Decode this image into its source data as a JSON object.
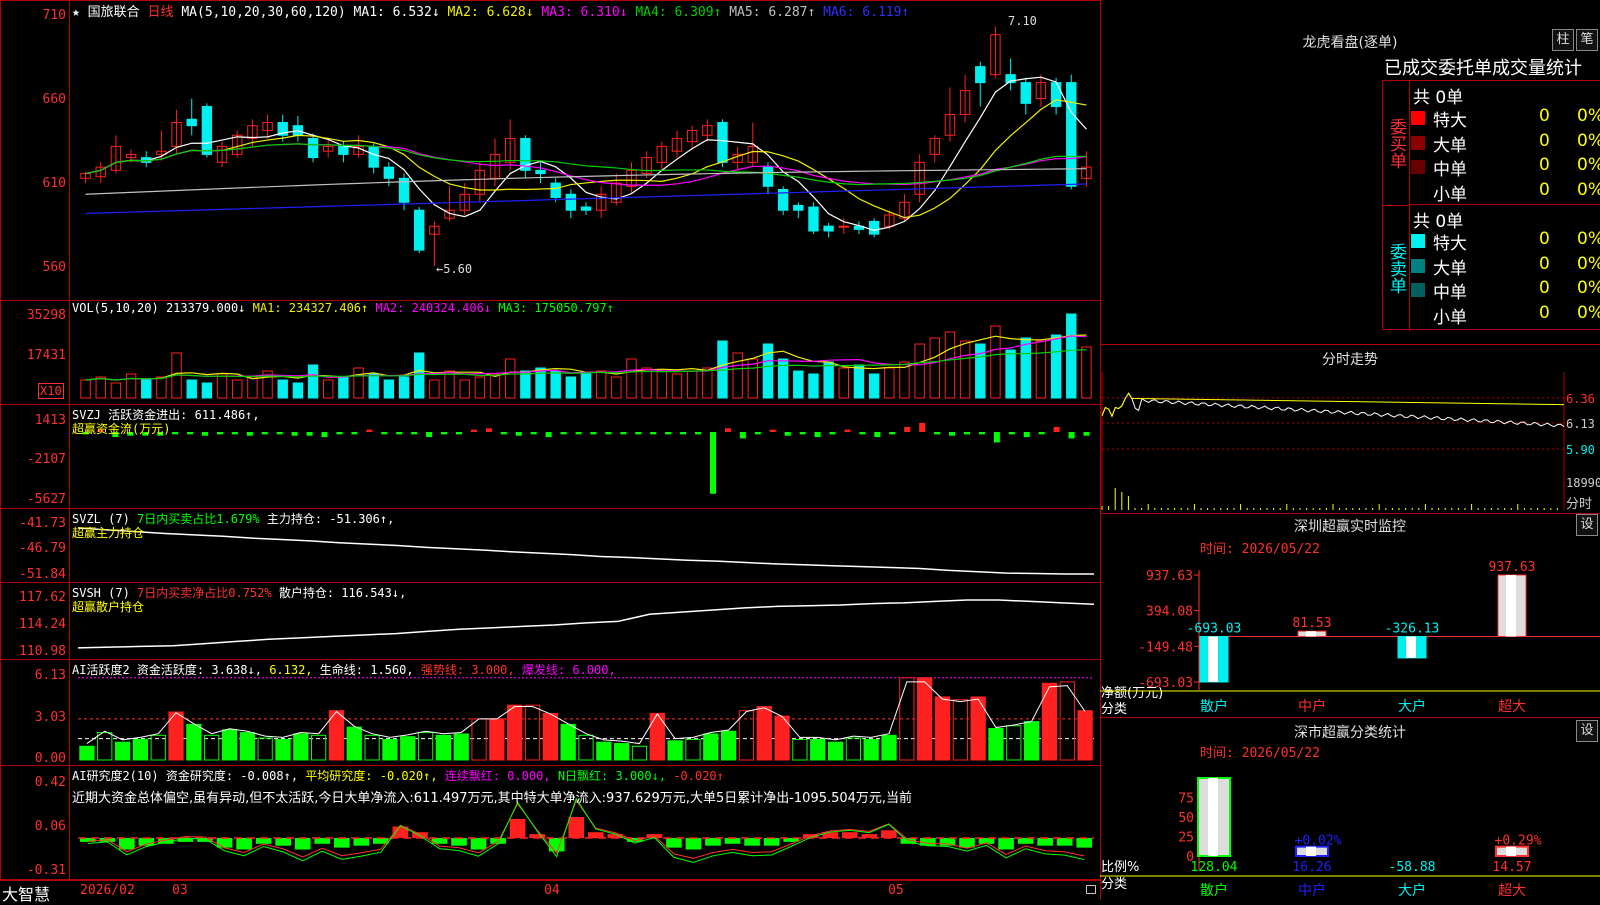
{
  "colors": {
    "up": "#ff2020",
    "down": "#00f0f0",
    "grid": "#b00000",
    "ma1": "#ffffff",
    "ma2": "#f0f000",
    "ma3": "#ff00ff",
    "ma4": "#00d000",
    "ma5": "#c0c0c0",
    "ma6": "#2020ff",
    "green": "#00ff00",
    "yellow": "#ffff00"
  },
  "main": {
    "star": "★",
    "name": "国旅联合",
    "period": "日线",
    "ma_params": "MA(5,10,20,30,60,120)",
    "ma1": "MA1: 6.532↓",
    "ma2": "MA2: 6.628↓",
    "ma3": "MA3: 6.310↓",
    "ma4": "MA4: 6.309↑",
    "ma5": "MA5: 6.287↑",
    "ma6": "MA6: 6.119↑",
    "axis": [
      "710",
      "660",
      "610",
      "560"
    ],
    "hi_label": "7.10",
    "lo_label": "←5.60"
  },
  "vol": {
    "title": "VOL(5,10,20)",
    "value": "213379.000↓",
    "ma1": "MA1: 234327.406↑",
    "ma2": "MA2: 240324.406↓",
    "ma3": "MA3: 175050.797↑",
    "axis": [
      "35298",
      "17431"
    ],
    "unit": "X10"
  },
  "svzj": {
    "title": "SVZJ",
    "name": "活跃资金进出:",
    "value": "611.486↑,",
    "sub": "超赢资金流(万元)",
    "axis": [
      "1413",
      "-2107",
      "-5627"
    ]
  },
  "svzl": {
    "title": "SVZL (7)",
    "ratio": "7日内买卖占比1.679%",
    "holding": "主力持仓: -51.306↑,",
    "sub": "超赢主力持仓",
    "axis": [
      "-41.73",
      "-46.79",
      "-51.84"
    ]
  },
  "svsh": {
    "title": "SVSH (7)",
    "ratio": "7日内买卖净占比0.752%",
    "holding": "散户持仓: 116.543↓,",
    "sub": "超赢散户持仓",
    "axis": [
      "117.62",
      "114.24",
      "110.98"
    ]
  },
  "ai1": {
    "title": "AI活跃度2",
    "v1": "资金活跃度: 3.638↓,",
    "v2": "6.132,",
    "v3": "生命线: 1.560,",
    "v4": "强势线: 3.000,",
    "v5": "爆发线: 6.000,",
    "axis": [
      "6.13",
      "3.03",
      "0.00"
    ]
  },
  "ai2": {
    "title": "AI研究度2(10)",
    "v1": "资金研究度: -0.008↑,",
    "v2": "平均研究度: -0.020↑,",
    "v3": "连续飘红: 0.000,",
    "v4": "N日飘红: 3.000↓,",
    "v5": "-0.020↑",
    "comment": "近期大资金总体偏空,虽有异动,但不太活跃,今日大单净流入:611.497万元,其中特大单净流入:937.629万元,大单5日累计净出-1095.504万元,当前",
    "axis": [
      "0.42",
      "0.06",
      "-0.31"
    ]
  },
  "dates": {
    "brand": "大智慧",
    "d1": "2026/02",
    "d2": "03",
    "d3": "04",
    "d4": "05"
  },
  "right": {
    "title": "龙虎看盘(逐单)",
    "btn1": "柱",
    "btn2": "笔",
    "table_title": "已成交委托单成交量统计",
    "buy_label": "委买单",
    "sell_label": "委卖单",
    "buy_total": "共 0单",
    "sell_total": "共 0单",
    "rows": [
      {
        "name": "特大",
        "count": "0",
        "pct": "0%"
      },
      {
        "name": "大单",
        "count": "0",
        "pct": "0%"
      },
      {
        "name": "中单",
        "count": "0",
        "pct": "0%"
      },
      {
        "name": "小单",
        "count": "0",
        "pct": "0%"
      }
    ],
    "fenshi_title": "分时走势",
    "fenshi_axis": [
      "6.36",
      "6.13",
      "5.90"
    ],
    "fenshi_vol": "18990",
    "fenshi_unit": "分时",
    "sz_title": "深圳超赢实时监控",
    "sz_btn": "设",
    "sz_time": "时间: 2026/05/22",
    "sz_axis": [
      "937.63",
      "394.08",
      "-149.48",
      "-693.03"
    ],
    "sz_bars": [
      {
        "cat": "散户",
        "value": -693.03,
        "label": "-693.03"
      },
      {
        "cat": "中户",
        "value": 81.53,
        "label": "81.53"
      },
      {
        "cat": "大户",
        "value": -326.13,
        "label": "-326.13"
      },
      {
        "cat": "超大",
        "value": 937.63,
        "label": "937.63"
      }
    ],
    "sz_ylabel": "净额(万元)",
    "sz_xlabel": "分类",
    "sc_title": "深市超赢分类统计",
    "sc_btn": "设",
    "sc_time": "时间: 2026/05/22",
    "sc_axis": [
      "75",
      "50",
      "25",
      "0"
    ],
    "sc_bars": [
      {
        "cat": "散户",
        "value": 128.04,
        "label": "128.04",
        "pct": ""
      },
      {
        "cat": "中户",
        "value": 16.26,
        "label": "16.26",
        "pct": "+0.02%"
      },
      {
        "cat": "大户",
        "value": -58.88,
        "label": "-58.88",
        "pct": ""
      },
      {
        "cat": "超大",
        "value": 14.57,
        "label": "14.57",
        "pct": "+0.29%"
      }
    ],
    "sc_ylabel": "比例%",
    "sc_xlabel": "分类"
  },
  "chart_data": {
    "type": "candlestick",
    "title": "国旅联合 日线",
    "y_range": [
      5.45,
      7.18
    ],
    "candles": [
      [
        6.15,
        6.18,
        6.12,
        6.19
      ],
      [
        6.16,
        6.22,
        6.12,
        6.25
      ],
      [
        6.2,
        6.35,
        6.18,
        6.42
      ],
      [
        6.28,
        6.3,
        6.25,
        6.33
      ],
      [
        6.28,
        6.25,
        6.22,
        6.32
      ],
      [
        6.3,
        6.32,
        6.26,
        6.45
      ],
      [
        6.35,
        6.5,
        6.3,
        6.58
      ],
      [
        6.52,
        6.48,
        6.42,
        6.65
      ],
      [
        6.6,
        6.3,
        6.28,
        6.62
      ],
      [
        6.25,
        6.35,
        6.22,
        6.38
      ],
      [
        6.3,
        6.42,
        6.28,
        6.45
      ],
      [
        6.4,
        6.48,
        6.35,
        6.52
      ],
      [
        6.45,
        6.5,
        6.4,
        6.55
      ],
      [
        6.5,
        6.42,
        6.38,
        6.55
      ],
      [
        6.48,
        6.42,
        6.38,
        6.54
      ],
      [
        6.4,
        6.28,
        6.25,
        6.43
      ],
      [
        6.32,
        6.35,
        6.28,
        6.4
      ],
      [
        6.35,
        6.3,
        6.25,
        6.38
      ],
      [
        6.3,
        6.35,
        6.28,
        6.42
      ],
      [
        6.35,
        6.22,
        6.18,
        6.37
      ],
      [
        6.22,
        6.15,
        6.1,
        6.25
      ],
      [
        6.15,
        6.0,
        5.95,
        6.18
      ],
      [
        5.95,
        5.7,
        5.68,
        5.97
      ],
      [
        5.8,
        5.85,
        5.6,
        5.88
      ],
      [
        5.9,
        5.95,
        5.88,
        6.1
      ],
      [
        5.95,
        6.05,
        5.92,
        6.12
      ],
      [
        6.05,
        6.2,
        6.0,
        6.25
      ],
      [
        6.15,
        6.3,
        6.1,
        6.4
      ],
      [
        6.25,
        6.4,
        6.2,
        6.52
      ],
      [
        6.4,
        6.2,
        6.15,
        6.42
      ],
      [
        6.2,
        6.18,
        6.12,
        6.25
      ],
      [
        6.12,
        6.03,
        6.0,
        6.15
      ],
      [
        6.05,
        5.95,
        5.9,
        6.08
      ],
      [
        5.97,
        5.95,
        5.92,
        6.0
      ],
      [
        5.95,
        6.05,
        5.9,
        6.1
      ],
      [
        6.0,
        6.12,
        5.98,
        6.18
      ],
      [
        6.1,
        6.2,
        6.05,
        6.25
      ],
      [
        6.18,
        6.28,
        6.15,
        6.32
      ],
      [
        6.25,
        6.35,
        6.2,
        6.38
      ],
      [
        6.32,
        6.4,
        6.28,
        6.45
      ],
      [
        6.38,
        6.45,
        6.33,
        6.48
      ],
      [
        6.42,
        6.48,
        6.38,
        6.52
      ],
      [
        6.5,
        6.25,
        6.22,
        6.52
      ],
      [
        6.25,
        6.3,
        6.2,
        6.35
      ],
      [
        6.25,
        6.35,
        6.22,
        6.5
      ],
      [
        6.22,
        6.1,
        6.05,
        6.25
      ],
      [
        6.08,
        5.95,
        5.92,
        6.1
      ],
      [
        5.98,
        5.95,
        5.9,
        6.0
      ],
      [
        5.97,
        5.82,
        5.8,
        6.0
      ],
      [
        5.85,
        5.82,
        5.78,
        5.87
      ],
      [
        5.85,
        5.85,
        5.8,
        5.9
      ],
      [
        5.85,
        5.83,
        5.8,
        5.88
      ],
      [
        5.88,
        5.8,
        5.78,
        5.9
      ],
      [
        5.85,
        5.92,
        5.83,
        5.95
      ],
      [
        5.9,
        6.0,
        5.88,
        6.05
      ],
      [
        6.05,
        6.25,
        6.0,
        6.3
      ],
      [
        6.3,
        6.4,
        6.25,
        6.42
      ],
      [
        6.42,
        6.55,
        6.38,
        6.72
      ],
      [
        6.55,
        6.7,
        6.5,
        6.8
      ],
      [
        6.85,
        6.75,
        6.6,
        6.88
      ],
      [
        6.8,
        7.05,
        6.78,
        7.1
      ],
      [
        6.8,
        6.75,
        6.7,
        6.9
      ],
      [
        6.75,
        6.62,
        6.55,
        6.78
      ],
      [
        6.65,
        6.75,
        6.6,
        6.8
      ],
      [
        6.75,
        6.6,
        6.55,
        6.78
      ],
      [
        6.75,
        6.1,
        6.08,
        6.8
      ],
      [
        6.15,
        6.22,
        6.1,
        6.32
      ]
    ],
    "volume": [
      12,
      14,
      10,
      16,
      12,
      14,
      30,
      12,
      10,
      16,
      12,
      14,
      18,
      12,
      10,
      22,
      12,
      14,
      20,
      16,
      12,
      14,
      30,
      12,
      18,
      12,
      14,
      16,
      26,
      18,
      20,
      18,
      14,
      16,
      18,
      14,
      26,
      20,
      18,
      16,
      18,
      20,
      38,
      30,
      26,
      36,
      26,
      18,
      16,
      24,
      20,
      22,
      16,
      20,
      24,
      36,
      40,
      44,
      38,
      36,
      48,
      32,
      40,
      38,
      42,
      56,
      34
    ],
    "svzj": [
      -1,
      1,
      -3,
      -2,
      -2,
      -2,
      -1,
      -1,
      -2,
      -1,
      -1,
      -2,
      -1,
      -1,
      -2,
      -2,
      -3,
      -1,
      -1,
      1,
      -1,
      -1,
      -1,
      -3,
      -1,
      -1,
      1,
      2,
      -1,
      -2,
      -1,
      -3,
      -1,
      -1,
      -1,
      -1,
      -1,
      -1,
      -1,
      -1,
      -1,
      -1,
      -45,
      2,
      -4,
      -1,
      1,
      -2,
      -1,
      -3,
      -1,
      1,
      -1,
      -3,
      -1,
      3,
      6,
      -1,
      -2,
      -1,
      -1,
      -7,
      -1,
      -3,
      -1,
      3,
      -4,
      -2
    ],
    "svzl": [
      -41.8,
      -42.2,
      -42.6,
      -43.0,
      -43.3,
      -43.6,
      -44.0,
      -44.3,
      -44.6,
      -45.0,
      -45.3,
      -45.6,
      -46.0,
      -46.3,
      -46.6,
      -47.0,
      -47.3,
      -47.6,
      -48.0,
      -48.2,
      -48.5,
      -48.8,
      -49.0,
      -49.3,
      -49.6,
      -49.8,
      -50.0,
      -50.2,
      -50.4,
      -50.6,
      -51.0,
      -51.3,
      -51.6,
      -51.7,
      -51.8,
      -51.8
    ],
    "svsh": [
      111.3,
      111.4,
      111.5,
      111.6,
      111.9,
      112.2,
      112.5,
      112.7,
      112.9,
      113.1,
      113.3,
      113.6,
      113.9,
      114.1,
      114.3,
      114.5,
      114.8,
      115.0,
      116.0,
      116.3,
      116.6,
      116.9,
      117.1,
      117.2,
      117.3,
      117.5,
      117.6,
      117.8,
      118.0,
      118.0,
      117.8,
      117.6,
      117.4
    ],
    "ai1": [
      1.0,
      2.0,
      1.3,
      1.5,
      1.8,
      3.5,
      2.6,
      1.8,
      2.2,
      2.0,
      1.6,
      1.5,
      1.9,
      1.8,
      3.6,
      2.4,
      1.8,
      1.5,
      1.7,
      2.0,
      1.8,
      1.9,
      3.0,
      3.0,
      4.0,
      4.0,
      3.4,
      2.6,
      1.8,
      1.3,
      1.2,
      1.0,
      3.4,
      1.4,
      1.5,
      1.9,
      2.1,
      3.6,
      3.9,
      3.2,
      1.5,
      1.5,
      1.3,
      1.6,
      1.5,
      1.8,
      6.0,
      6.0,
      4.6,
      4.4,
      4.6,
      2.3,
      2.5,
      2.8,
      5.6,
      5.7,
      3.6
    ],
    "ai2": [
      -0.01,
      -0.01,
      -0.05,
      -0.03,
      -0.02,
      -0.01,
      -0.01,
      -0.04,
      -0.05,
      -0.02,
      -0.03,
      -0.05,
      -0.02,
      -0.04,
      -0.03,
      -0.02,
      0.05,
      0.02,
      -0.02,
      -0.03,
      -0.05,
      -0.02,
      0.09,
      0.01,
      -0.06,
      0.1,
      0.02,
      0.01,
      -0.01,
      0.01,
      -0.04,
      -0.05,
      -0.03,
      -0.02,
      -0.03,
      -0.03,
      -0.01,
      0.01,
      0.02,
      0.02,
      0.01,
      0.03,
      -0.02,
      -0.03,
      -0.03,
      -0.04,
      -0.02,
      -0.05,
      -0.02,
      -0.03,
      -0.03,
      -0.04
    ]
  }
}
